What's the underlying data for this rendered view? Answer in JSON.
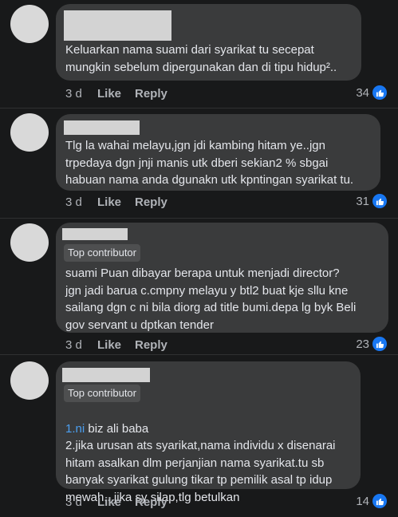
{
  "comments": [
    {
      "badge": "",
      "text_link": "",
      "text": "Keluarkan nama suami dari syarikat tu secepat\nmungkin sebelum dipergunakan dan di tipu hidup².. ",
      "time": "3 d",
      "like_label": "Like",
      "reply_label": "Reply",
      "reaction_count": "34",
      "reaction_icon": "like-icon"
    },
    {
      "badge": "",
      "text_link": "",
      "text": "Tlg la wahai melayu,jgn jdi kambing hitam ye..jgn\ntrpedaya dgn jnji manis utk dberi sekian2 % sbgai\nhabuan nama anda dgunakn utk kpntingan syarikat tu.",
      "time": "3 d",
      "like_label": "Like",
      "reply_label": "Reply",
      "reaction_count": "31",
      "reaction_icon": "like-icon"
    },
    {
      "badge": "Top contributor",
      "text_link": "",
      "text": "suami Puan dibayar berapa untuk menjadi director?\njgn jadi barua c.cmpny melayu y btl2 buat kje sllu kne\nsailang dgn c ni bila diorg ad title bumi.depa lg byk Beli\ngov servant u dptkan tender",
      "time": "3 d",
      "like_label": "Like",
      "reply_label": "Reply",
      "reaction_count": "23",
      "reaction_icon": "like-icon"
    },
    {
      "badge": "Top contributor",
      "text_link": "1.ni",
      "text": " biz ali baba\n2.jika urusan ats syarikat,nama individu x disenarai\nhitam asalkan dlm perjanjian nama syarikat.tu sb\nbanyak syarikat gulung tikar tp pemilik asal tp idup\nmewah...jika sy silap,tlg betulkan",
      "time": "3 d",
      "like_label": "Like",
      "reply_label": "Reply",
      "reaction_count": "14",
      "reaction_icon": "like-icon"
    }
  ]
}
